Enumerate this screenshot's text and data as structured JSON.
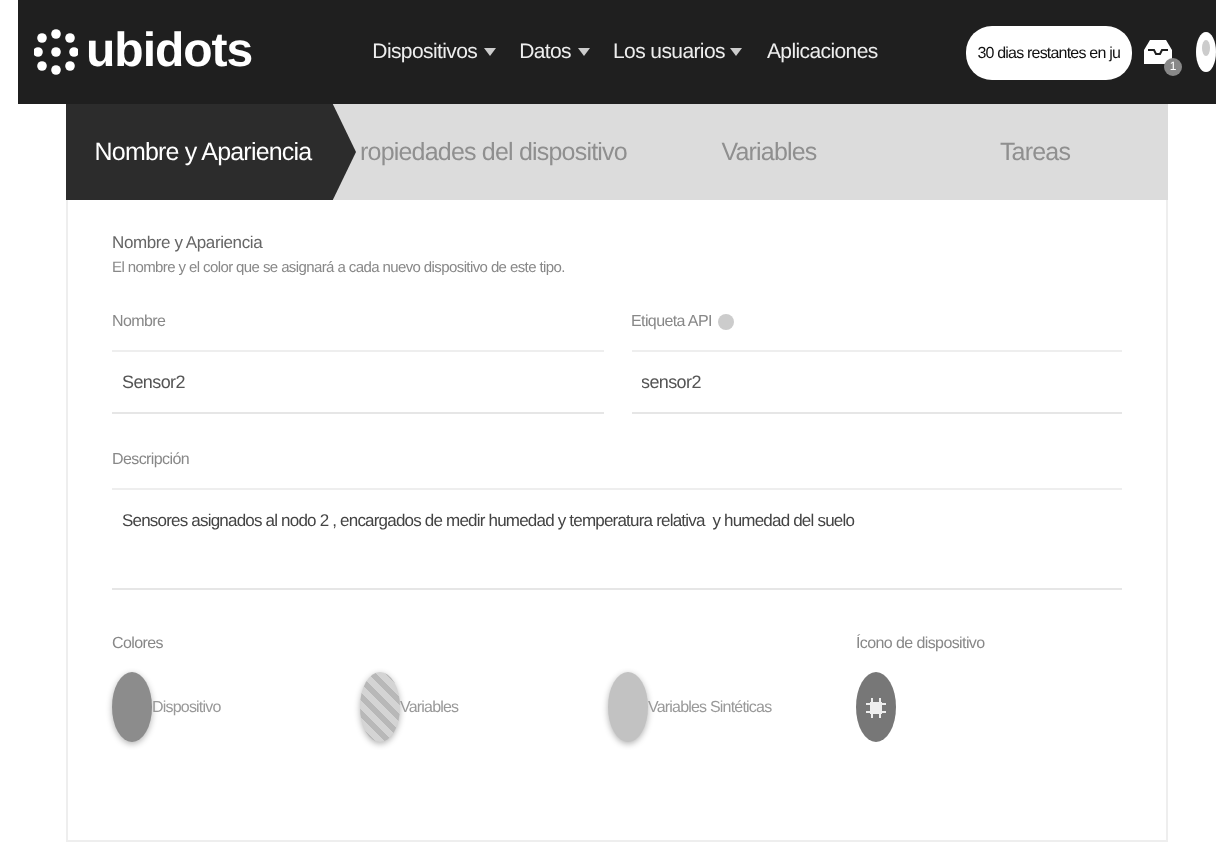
{
  "navbar": {
    "logo": "ubidots",
    "menu": [
      {
        "label": "Dispositivos",
        "dropdown": true
      },
      {
        "label": "Datos",
        "dropdown": true
      },
      {
        "label": "Los usuarios",
        "dropdown": true
      },
      {
        "label": "Aplicaciones",
        "dropdown": false
      }
    ],
    "trial": "30 dias restantes en ju",
    "inbox_count": "1"
  },
  "steps": [
    {
      "label": "Nombre y Apariencia",
      "selected": true
    },
    {
      "label": "ropiedades del dispositivo",
      "selected": false
    },
    {
      "label": "Variables",
      "selected": false
    },
    {
      "label": "Tareas",
      "selected": false
    }
  ],
  "section": {
    "title": "Nombre y Apariencia",
    "subtitle": "El nombre y el color que se asignará a cada nuevo dispositivo de este tipo."
  },
  "fields": [
    {
      "label": "Nombre",
      "value": "Sensor2",
      "info": false
    },
    {
      "label": "Etiqueta API",
      "value": "sensor2",
      "info": true
    }
  ],
  "description": {
    "label": "Descripción",
    "value": "Sensores asignados al nodo 2 , encargados de medir humedad y temperatura relativa  y humedad del suelo"
  },
  "colors": {
    "label": "Colores",
    "items": [
      {
        "label": "Dispositivo",
        "color": "#8c8c8c",
        "kind": "solid"
      },
      {
        "label": "Variables",
        "color": "#c4c4c4",
        "kind": "pattern"
      },
      {
        "label": "Variables Sintéticas",
        "color": "#c2c2c2",
        "kind": "solid"
      }
    ]
  },
  "device_icon": {
    "label": "Ícono de dispositivo"
  }
}
